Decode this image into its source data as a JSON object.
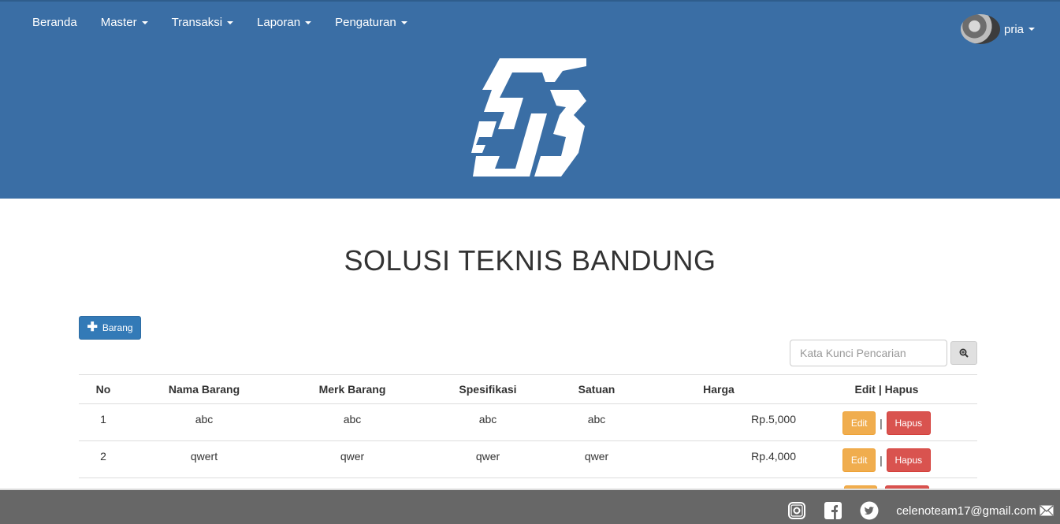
{
  "nav": {
    "items": [
      {
        "label": "Beranda",
        "dropdown": false
      },
      {
        "label": "Master",
        "dropdown": true
      },
      {
        "label": "Transaksi",
        "dropdown": true
      },
      {
        "label": "Laporan",
        "dropdown": true
      },
      {
        "label": "Pengaturan",
        "dropdown": true
      }
    ],
    "user": "pria"
  },
  "page_title": "SOLUSI TEKNIS BANDUNG",
  "add_button_label": "Barang",
  "search": {
    "placeholder": "Kata Kunci Pencarian",
    "value": ""
  },
  "table": {
    "headers": [
      "No",
      "Nama Barang",
      "Merk Barang",
      "Spesifikasi",
      "Satuan",
      "Harga",
      "Edit | Hapus"
    ],
    "rows": [
      {
        "no": "1",
        "nama": "abc",
        "merk": "abc",
        "spesifikasi": "abc",
        "satuan": "abc",
        "harga": "Rp.5,000"
      },
      {
        "no": "2",
        "nama": "qwert",
        "merk": "qwer",
        "spesifikasi": "qwer",
        "satuan": "qwer",
        "harga": "Rp.4,000"
      }
    ],
    "edit_label": "Edit",
    "hapus_label": "Hapus",
    "separator": "|"
  },
  "footer": {
    "icons": [
      "instagram-icon",
      "facebook-icon",
      "twitter-icon",
      "mail-icon"
    ],
    "email": "celenoteam17@gmail.com"
  },
  "colors": {
    "header_bg": "#3a6ea5",
    "primary": "#337ab7",
    "warning": "#f0ad4e",
    "danger": "#d9534f",
    "footer_bg": "#676767"
  }
}
